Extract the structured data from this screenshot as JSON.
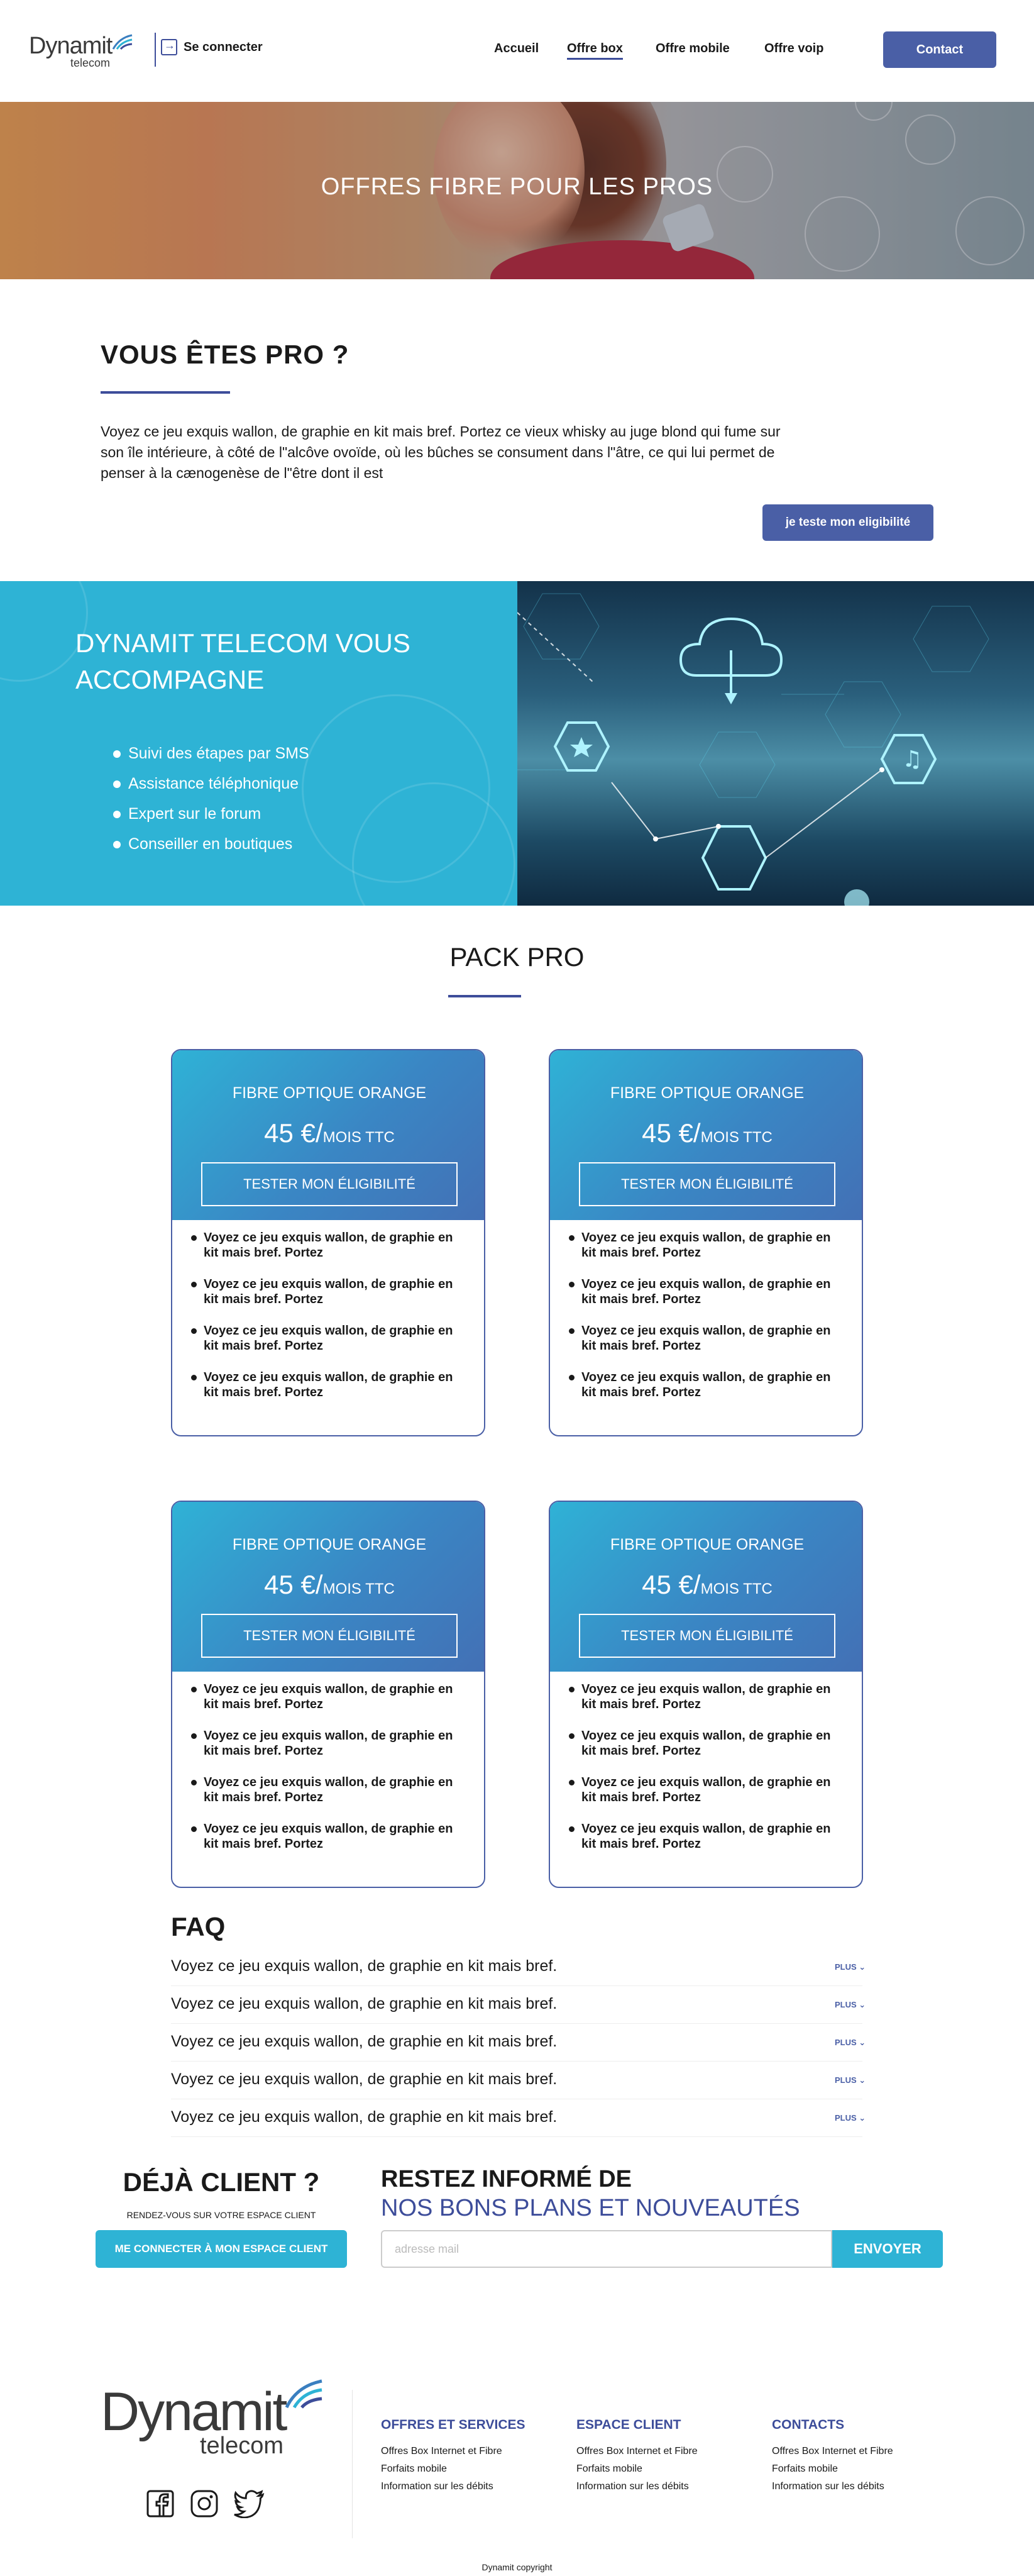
{
  "brand": {
    "name": "Dynamit",
    "sub": "telecom",
    "accent": "#4a5fa6",
    "cyan": "#2eb3d5"
  },
  "header": {
    "login_label": "Se connecter",
    "nav": [
      "Accueil",
      "Offre box",
      "Offre mobile",
      "Offre voip"
    ],
    "active_nav": "Offre box",
    "contact_label": "Contact"
  },
  "hero": {
    "title": "OFFRES FIBRE POUR LES PROS"
  },
  "pro": {
    "title": "VOUS ÊTES PRO ?",
    "text": "Voyez ce jeu exquis wallon, de graphie en kit mais bref. Portez ce vieux whisky au juge blond qui fume sur son île intérieure, à côté de l\"alcôve ovoïde, où les bûches se consument dans l\"âtre, ce qui lui permet de penser à la cænogenèse de l\"être dont il est",
    "button_label": "je teste mon eligibilité"
  },
  "accompagne": {
    "title": "DYNAMIT TELECOM VOUS ACCOMPAGNE",
    "items": [
      "Suivi des étapes par SMS",
      "Assistance téléphonique",
      "Expert sur le forum",
      "Conseiller en boutiques"
    ]
  },
  "pack": {
    "title": "PACK PRO",
    "cards": [
      {
        "title": "FIBRE OPTIQUE ORANGE",
        "price": "45 €/",
        "per": "MOIS TTC",
        "button": "TESTER MON ÉLIGIBILITÉ",
        "features": [
          "Voyez ce jeu exquis wallon, de graphie en kit mais bref. Portez",
          "Voyez ce jeu exquis wallon, de graphie en kit mais bref. Portez",
          "Voyez ce jeu exquis wallon, de graphie en kit mais bref. Portez",
          "Voyez ce jeu exquis wallon, de graphie en kit mais bref. Portez"
        ]
      },
      {
        "title": "FIBRE OPTIQUE ORANGE",
        "price": "45 €/",
        "per": "MOIS TTC",
        "button": "TESTER MON ÉLIGIBILITÉ",
        "features": [
          "Voyez ce jeu exquis wallon, de graphie en kit mais bref. Portez",
          "Voyez ce jeu exquis wallon, de graphie en kit mais bref. Portez",
          "Voyez ce jeu exquis wallon, de graphie en kit mais bref. Portez",
          "Voyez ce jeu exquis wallon, de graphie en kit mais bref. Portez"
        ]
      },
      {
        "title": "FIBRE OPTIQUE ORANGE",
        "price": "45 €/",
        "per": "MOIS TTC",
        "button": "TESTER MON ÉLIGIBILITÉ",
        "features": [
          "Voyez ce jeu exquis wallon, de graphie en kit mais bref. Portez",
          "Voyez ce jeu exquis wallon, de graphie en kit mais bref. Portez",
          "Voyez ce jeu exquis wallon, de graphie en kit mais bref. Portez",
          "Voyez ce jeu exquis wallon, de graphie en kit mais bref. Portez"
        ]
      },
      {
        "title": "FIBRE OPTIQUE ORANGE",
        "price": "45 €/",
        "per": "MOIS TTC",
        "button": "TESTER MON ÉLIGIBILITÉ",
        "features": [
          "Voyez ce jeu exquis wallon, de graphie en kit mais bref. Portez",
          "Voyez ce jeu exquis wallon, de graphie en kit mais bref. Portez",
          "Voyez ce jeu exquis wallon, de graphie en kit mais bref. Portez",
          "Voyez ce jeu exquis wallon, de graphie en kit mais bref. Portez"
        ]
      }
    ]
  },
  "faq": {
    "title": "FAQ",
    "more_label": "PLUS",
    "questions": [
      "Voyez ce jeu exquis wallon, de graphie en kit mais bref.",
      "Voyez ce jeu exquis wallon, de graphie en kit mais bref.",
      "Voyez ce jeu exquis wallon, de graphie en kit mais bref.",
      "Voyez ce jeu exquis wallon, de graphie en kit mais bref.",
      "Voyez ce jeu exquis wallon, de graphie en kit mais bref."
    ]
  },
  "client": {
    "title": "DÉJÀ CLIENT ?",
    "subtitle": "RENDEZ-VOUS SUR VOTRE ESPACE CLIENT",
    "button": "ME CONNECTER À MON ESPACE CLIENT"
  },
  "newsletter": {
    "title_1": "RESTEZ INFORMÉ DE",
    "title_2": "NOS BONS PLANS ET NOUVEAUTÉS",
    "placeholder": "adresse mail",
    "button": "ENVOYER"
  },
  "footer": {
    "socials": [
      "facebook-icon",
      "instagram-icon",
      "twitter-icon"
    ],
    "columns": [
      {
        "title": "OFFRES ET SERVICES",
        "links": [
          "Offres Box Internet et Fibre",
          "Forfaits mobile",
          "Information sur les débits"
        ]
      },
      {
        "title": "ESPACE CLIENT",
        "links": [
          "Offres Box Internet et Fibre",
          "Forfaits mobile",
          "Information sur les débits"
        ]
      },
      {
        "title": "CONTACTS",
        "links": [
          "Offres Box Internet et Fibre",
          "Forfaits mobile",
          "Information sur les débits"
        ]
      }
    ],
    "copyright": "Dynamit copyright"
  }
}
